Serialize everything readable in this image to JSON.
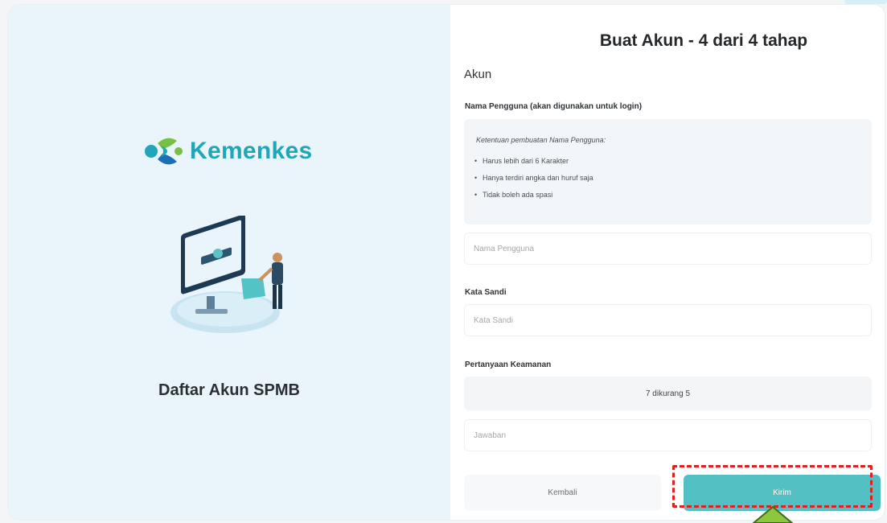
{
  "brand": {
    "name": "Kemenkes",
    "colors": {
      "teal": "#1fa6b8",
      "green": "#76c043",
      "blue": "#1b6fb4"
    }
  },
  "left_panel": {
    "title": "Daftar Akun SPMB",
    "illustration": "computer-user-illustration"
  },
  "form": {
    "title": "Buat Akun - 4 dari 4 tahap",
    "section": "Akun",
    "username": {
      "label": "Nama Pengguna (akan digunakan untuk login)",
      "rules_intro": "Ketentuan pembuatan Nama Pengguna:",
      "rules": [
        "Harus lebih dari 6 Karakter",
        "Hanya terdiri angka dan huruf saja",
        "Tidak boleh ada spasi"
      ],
      "placeholder": "Nama Pengguna",
      "value": ""
    },
    "password": {
      "label": "Kata Sandi",
      "placeholder": "Kata Sandi",
      "value": ""
    },
    "security": {
      "label": "Pertanyaan Keamanan",
      "question": "7 dikurang 5",
      "placeholder": "Jawaban",
      "value": ""
    },
    "buttons": {
      "back": "Kembali",
      "submit": "Kirim"
    }
  },
  "colors": {
    "accent": "#52bfc3",
    "left_background": "#e9f4fb",
    "highlight": "#e02020",
    "pointer": "#8dc63f"
  }
}
